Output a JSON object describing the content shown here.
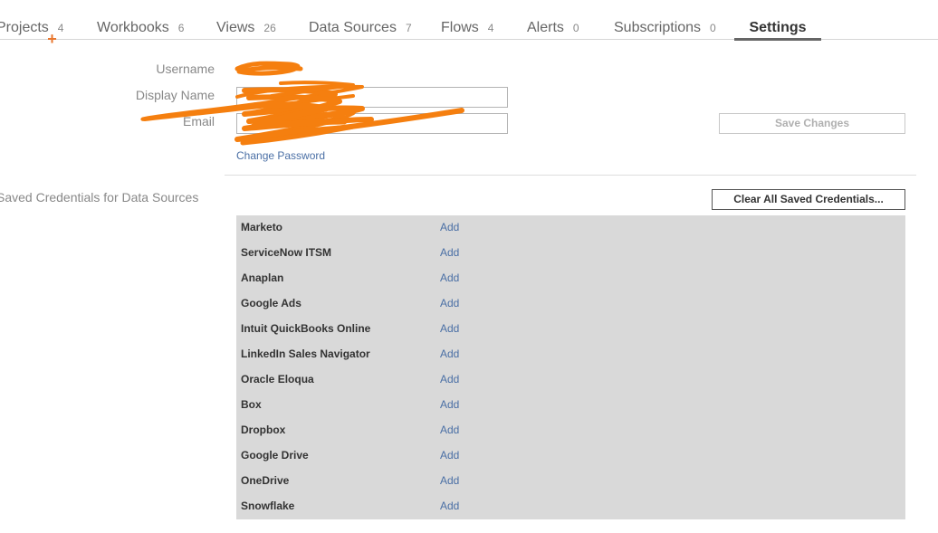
{
  "tabs": [
    {
      "label": "Projects",
      "count": "4"
    },
    {
      "label": "Workbooks",
      "count": "6"
    },
    {
      "label": "Views",
      "count": "26"
    },
    {
      "label": "Data Sources",
      "count": "7"
    },
    {
      "label": "Flows",
      "count": "4"
    },
    {
      "label": "Alerts",
      "count": "0"
    },
    {
      "label": "Subscriptions",
      "count": "0"
    },
    {
      "label": "Settings"
    }
  ],
  "profile": {
    "username_label": "Username",
    "display_name_label": "Display Name",
    "email_label": "Email",
    "change_password": "Change Password",
    "save_changes": "Save Changes"
  },
  "credentials": {
    "title": "Saved Credentials for Data Sources",
    "clear_all": "Clear All Saved Credentials...",
    "rows": [
      {
        "name": "Marketo",
        "action": "Add"
      },
      {
        "name": "ServiceNow ITSM",
        "action": "Add"
      },
      {
        "name": "Anaplan",
        "action": "Add"
      },
      {
        "name": "Google Ads",
        "action": "Add"
      },
      {
        "name": "Intuit QuickBooks Online",
        "action": "Add"
      },
      {
        "name": "LinkedIn Sales Navigator",
        "action": "Add"
      },
      {
        "name": "Oracle Eloqua",
        "action": "Add"
      },
      {
        "name": "Box",
        "action": "Add"
      },
      {
        "name": "Dropbox",
        "action": "Add"
      },
      {
        "name": "Google Drive",
        "action": "Add"
      },
      {
        "name": "OneDrive",
        "action": "Add"
      },
      {
        "name": "Snowflake",
        "action": "Add"
      }
    ]
  },
  "colors": {
    "accent": "#e8762d",
    "redaction": "#f57f0f",
    "link": "#4a6fa5",
    "table_bg": "#d9d9d9"
  }
}
